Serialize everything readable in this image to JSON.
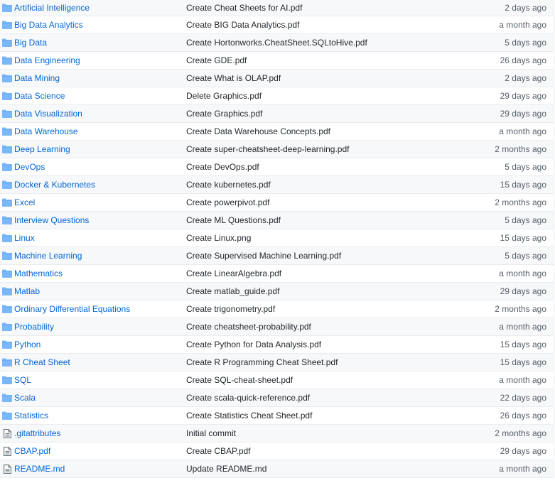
{
  "files": [
    {
      "name": "Artificial Intelligence",
      "type": "folder",
      "message": "Create Cheat Sheets for AI.pdf",
      "age": "2 days ago"
    },
    {
      "name": "Big Data Analytics",
      "type": "folder",
      "message": "Create BIG Data Analytics.pdf",
      "age": "a month ago"
    },
    {
      "name": "Big Data",
      "type": "folder",
      "message": "Create Hortonworks.CheatSheet.SQLtoHive.pdf",
      "age": "5 days ago"
    },
    {
      "name": "Data Engineering",
      "type": "folder",
      "message": "Create GDE.pdf",
      "age": "26 days ago"
    },
    {
      "name": "Data Mining",
      "type": "folder",
      "message": "Create What is OLAP.pdf",
      "age": "2 days ago"
    },
    {
      "name": "Data Science",
      "type": "folder",
      "message": "Delete Graphics.pdf",
      "age": "29 days ago"
    },
    {
      "name": "Data Visualization",
      "type": "folder",
      "message": "Create Graphics.pdf",
      "age": "29 days ago"
    },
    {
      "name": "Data Warehouse",
      "type": "folder",
      "message": "Create Data Warehouse Concepts.pdf",
      "age": "a month ago"
    },
    {
      "name": "Deep Learning",
      "type": "folder",
      "message": "Create super-cheatsheet-deep-learning.pdf",
      "age": "2 months ago"
    },
    {
      "name": "DevOps",
      "type": "folder",
      "message": "Create DevOps.pdf",
      "age": "5 days ago"
    },
    {
      "name": "Docker & Kubernetes",
      "type": "folder",
      "message": "Create kubernetes.pdf",
      "age": "15 days ago"
    },
    {
      "name": "Excel",
      "type": "folder",
      "message": "Create powerpivot.pdf",
      "age": "2 months ago"
    },
    {
      "name": "Interview Questions",
      "type": "folder",
      "message": "Create ML Questions.pdf",
      "age": "5 days ago"
    },
    {
      "name": "Linux",
      "type": "folder",
      "message": "Create Linux.png",
      "age": "15 days ago"
    },
    {
      "name": "Machine Learning",
      "type": "folder",
      "message": "Create Supervised Machine Learning.pdf",
      "age": "5 days ago"
    },
    {
      "name": "Mathematics",
      "type": "folder",
      "message": "Create LinearAlgebra.pdf",
      "age": "a month ago"
    },
    {
      "name": "Matlab",
      "type": "folder",
      "message": "Create matlab_guide.pdf",
      "age": "29 days ago"
    },
    {
      "name": "Ordinary Differential Equations",
      "type": "folder",
      "message": "Create trigonometry.pdf",
      "age": "2 months ago"
    },
    {
      "name": "Probability",
      "type": "folder",
      "message": "Create cheatsheet-probability.pdf",
      "age": "a month ago"
    },
    {
      "name": "Python",
      "type": "folder",
      "message": "Create Python for Data Analysis.pdf",
      "age": "15 days ago"
    },
    {
      "name": "R Cheat Sheet",
      "type": "folder",
      "message": "Create R Programming Cheat Sheet.pdf",
      "age": "15 days ago"
    },
    {
      "name": "SQL",
      "type": "folder",
      "message": "Create SQL-cheat-sheet.pdf",
      "age": "a month ago"
    },
    {
      "name": "Scala",
      "type": "folder",
      "message": "Create scala-quick-reference.pdf",
      "age": "22 days ago"
    },
    {
      "name": "Statistics",
      "type": "folder",
      "message": "Create Statistics Cheat Sheet.pdf",
      "age": "26 days ago"
    },
    {
      "name": ".gitattributes",
      "type": "file",
      "message": "Initial commit",
      "age": "2 months ago"
    },
    {
      "name": "CBAP.pdf",
      "type": "file",
      "message": "Create CBAP.pdf",
      "age": "29 days ago"
    },
    {
      "name": "README.md",
      "type": "file",
      "message": "Update README.md",
      "age": "a month ago"
    }
  ],
  "colors": {
    "link": "#0366d6",
    "folder_icon": "#79b8ff",
    "file_icon": "#6a737d",
    "muted": "#586069"
  }
}
